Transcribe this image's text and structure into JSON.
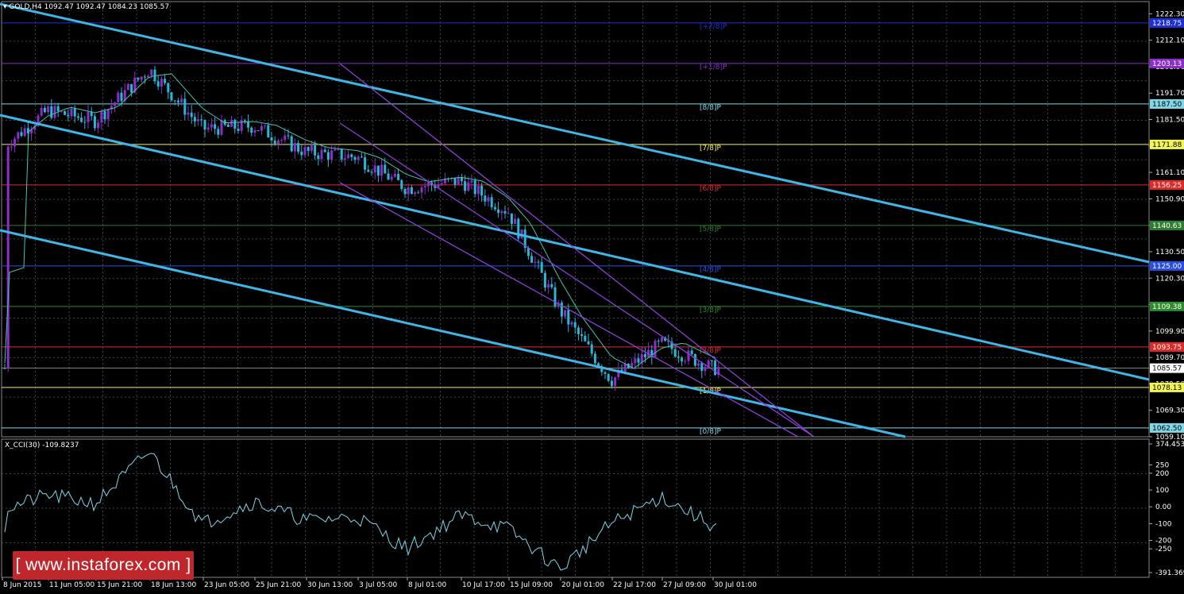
{
  "window": {
    "symbol_info": "GOLD,H4  1092.47 1092.47 1084.23 1085.57",
    "indicator_info": "X_CCI(30) -109.8237",
    "watermark": "[  www.instaforex.com ]"
  },
  "price_axis": {
    "ticks": [
      "1222.30",
      "1212.10",
      "1201.90",
      "1191.70",
      "1181.50",
      "1171.30",
      "1161.10",
      "1150.90",
      "1140.70",
      "1130.50",
      "1120.30",
      "1110.10",
      "1099.90",
      "1089.70",
      "1079.50",
      "1069.30",
      "1059.10"
    ],
    "current_price": "1085.57",
    "range": [
      1059.1,
      1227.0
    ]
  },
  "murrey_levels": [
    {
      "label": "[+2/8]P",
      "price": 1218.75,
      "price_text": "1218.75",
      "color": "#1e2fd6"
    },
    {
      "label": "[+1/8]P",
      "price": 1203.13,
      "price_text": "1203.13",
      "color": "#8b2fc9"
    },
    {
      "label": "[8/8]P",
      "price": 1187.5,
      "price_text": "1187.50",
      "color": "#7fd6e6"
    },
    {
      "label": "[7/8]P",
      "price": 1171.88,
      "price_text": "1171.88",
      "color": "#f2f25a"
    },
    {
      "label": "[6/8]P",
      "price": 1156.25,
      "price_text": "1156.25",
      "color": "#e02a2a"
    },
    {
      "label": "[5/8]P",
      "price": 1140.63,
      "price_text": "1140.63",
      "color": "#2e7d2e"
    },
    {
      "label": "[4/8]P",
      "price": 1125.0,
      "price_text": "1125.00",
      "color": "#2a4fe0"
    },
    {
      "label": "[3/8]P",
      "price": 1109.38,
      "price_text": "1109.38",
      "color": "#2e8b2e"
    },
    {
      "label": "[2/8]P",
      "price": 1093.75,
      "price_text": "1093.75",
      "color": "#e02a2a"
    },
    {
      "label": "[1/8]P",
      "price": 1078.13,
      "price_text": "1078.13",
      "color": "#f2f25a"
    },
    {
      "label": "[0/8]P",
      "price": 1062.5,
      "price_text": "1062.50",
      "color": "#7fd6e6"
    }
  ],
  "cci_axis": {
    "ticks": [
      "374.4537",
      "250",
      "200",
      "100",
      "0.00",
      "-100",
      "-200",
      "-250",
      "-391.369"
    ],
    "values": [
      374.45,
      250,
      200,
      100,
      0,
      -100,
      -200,
      -250,
      -391.37
    ]
  },
  "time_axis": {
    "labels": [
      "8 Jun 2015",
      "11 Jun 05:00",
      "15 Jun 21:00",
      "18 Jun 13:00",
      "23 Jun 05:00",
      "25 Jun 21:00",
      "30 Jun 13:00",
      "3 Jul 05:00",
      "8 Jul 01:00",
      "10 Jul 17:00",
      "15 Jul 09:00",
      "20 Jul 01:00",
      "22 Jul 17:00",
      "27 Jul 09:00",
      "30 Jul 01:00"
    ]
  },
  "colors": {
    "background": "#000000",
    "grid": "#3b4452",
    "bull_candle": "#8b2fc9",
    "bear_candle": "#2ab7d6",
    "ma_line": "#3fc6b0",
    "channel_main": "#3fb7e6",
    "channel_purple": "#8b3fd6",
    "cci_line": "#7fd6e6",
    "watermark_bg": "#c0272d"
  },
  "chart_data": {
    "type": "candlestick",
    "symbol": "GOLD",
    "timeframe": "H4",
    "close_path": [
      [
        "8 Jun 2015",
        1172
      ],
      [
        "11 Jun 05:00",
        1185
      ],
      [
        "15 Jun 21:00",
        1181
      ],
      [
        "18 Jun 13:00",
        1201
      ],
      [
        "23 Jun 05:00",
        1178
      ],
      [
        "25 Jun 21:00",
        1179
      ],
      [
        "30 Jun 13:00",
        1169
      ],
      [
        "3 Jul 05:00",
        1167
      ],
      [
        "8 Jul 01:00",
        1155
      ],
      [
        "10 Jul 17:00",
        1158
      ],
      [
        "15 Jul 09:00",
        1146
      ],
      [
        "20 Jul 01:00",
        1108
      ],
      [
        "22 Jul 17:00",
        1081
      ],
      [
        "27 Jul 09:00",
        1095
      ],
      [
        "30 Jul 01:00",
        1085.57
      ]
    ],
    "cci_path": [
      [
        "8 Jun 2015",
        -10
      ],
      [
        "11 Jun 05:00",
        70
      ],
      [
        "15 Jun 21:00",
        20
      ],
      [
        "18 Jun 13:00",
        330
      ],
      [
        "23 Jun 05:00",
        -100
      ],
      [
        "25 Jun 21:00",
        30
      ],
      [
        "30 Jun 13:00",
        -80
      ],
      [
        "3 Jul 05:00",
        -60
      ],
      [
        "8 Jul 01:00",
        -250
      ],
      [
        "10 Jul 17:00",
        -50
      ],
      [
        "15 Jul 09:00",
        -130
      ],
      [
        "20 Jul 01:00",
        -370
      ],
      [
        "22 Jul 17:00",
        -100
      ],
      [
        "27 Jul 09:00",
        60
      ],
      [
        "30 Jul 01:00",
        -109.82
      ]
    ]
  }
}
